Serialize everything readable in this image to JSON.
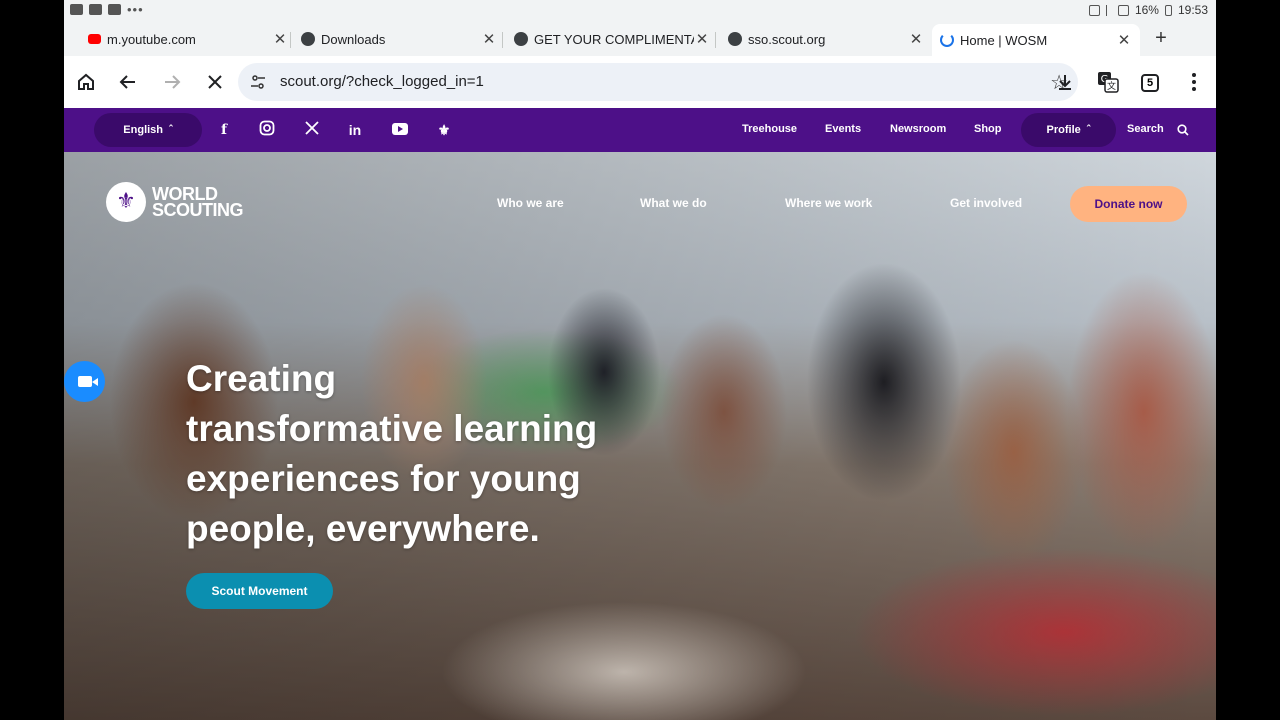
{
  "status_bar": {
    "battery": "16%",
    "time": "19:53"
  },
  "tabs": [
    {
      "title": "m.youtube.com"
    },
    {
      "title": "Downloads"
    },
    {
      "title": "GET YOUR COMPLIMENTAR"
    },
    {
      "title": "sso.scout.org"
    },
    {
      "title": "Home | WOSM"
    }
  ],
  "toolbar": {
    "url": "scout.org/?check_logged_in=1",
    "tab_count": "5"
  },
  "site_topbar": {
    "language": "English",
    "links": [
      "Treehouse",
      "Events",
      "Newsroom",
      "Shop"
    ],
    "profile": "Profile",
    "search": "Search"
  },
  "hero": {
    "logo_line1": "WORLD",
    "logo_line2": "SCOUTING",
    "nav": [
      "Who we are",
      "What we do",
      "Where we work",
      "Get involved"
    ],
    "donate": "Donate now",
    "headline": [
      "Creating",
      "transformative learning",
      "experiences for young",
      "people, everywhere."
    ],
    "cta": "Scout Movement"
  },
  "colors": {
    "purple": "#4d1088",
    "donate": "#ffb380",
    "cta": "#0b8fb0"
  }
}
